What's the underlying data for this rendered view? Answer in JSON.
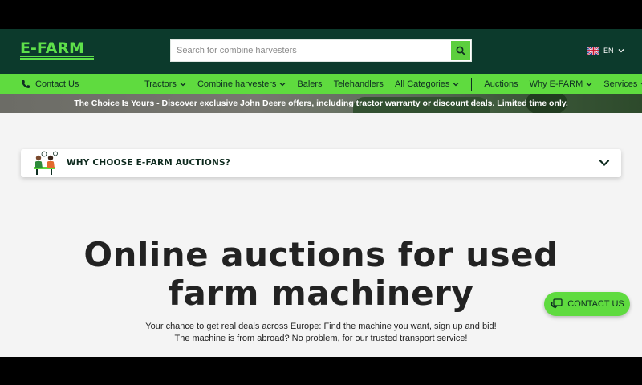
{
  "header": {
    "logo_text": "E-FARM",
    "search": {
      "placeholder": "Search for combine harvesters",
      "value": ""
    },
    "language": "EN"
  },
  "nav": {
    "contact_label": "Contact Us",
    "items": [
      {
        "label": "Tractors",
        "dropdown": true
      },
      {
        "label": "Combine harvesters",
        "dropdown": true
      },
      {
        "label": "Balers",
        "dropdown": false
      },
      {
        "label": "Telehandlers",
        "dropdown": false
      },
      {
        "label": "All Categories",
        "dropdown": true
      },
      {
        "label": "Auctions",
        "dropdown": false
      },
      {
        "label": "Why E-FARM",
        "dropdown": true
      },
      {
        "label": "Services",
        "dropdown": true
      }
    ]
  },
  "promo": {
    "text": "The Choice Is Yours - Discover exclusive John Deere offers, including tractor warranty or discount deals. Limited time only."
  },
  "why": {
    "title": "WHY CHOOSE E-FARM AUCTIONS?"
  },
  "hero": {
    "title_line1": "Online auctions for used",
    "title_line2": "farm machinery",
    "sub_line1": "Your chance to get real deals across Europe: Find the machine you want, sign up and bid!",
    "sub_line2": "The machine is from abroad? No problem, for our trusted transport service!"
  },
  "fab": {
    "label": "CONTACT US"
  },
  "colors": {
    "header_bg": "#0c3a2c",
    "accent_green": "#5fdb3f",
    "page_bg": "#f4f4f4"
  }
}
